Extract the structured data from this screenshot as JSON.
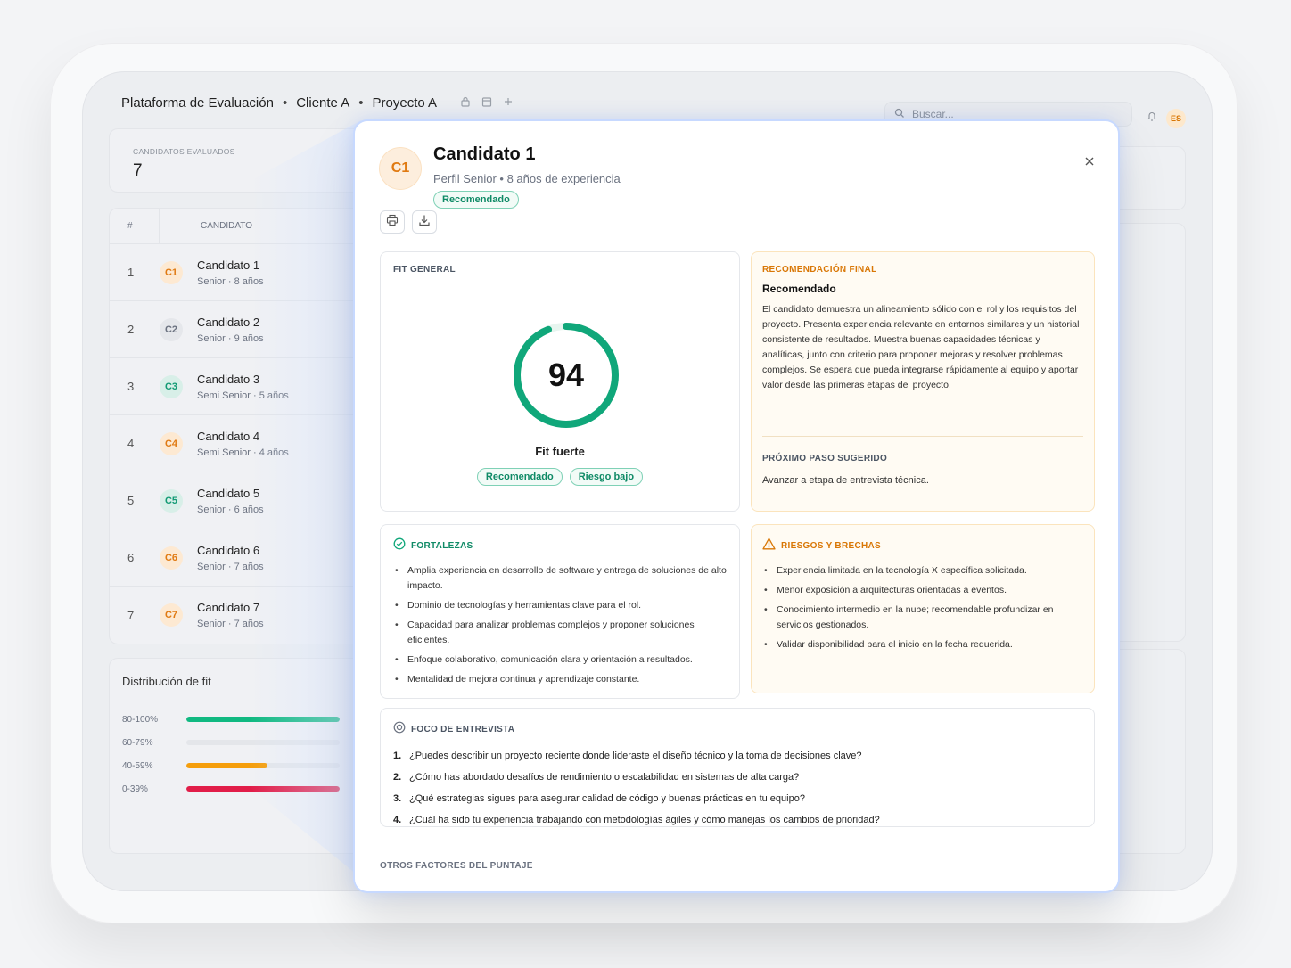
{
  "header": {
    "breadcrumbs": [
      "Plataforma de Evaluación",
      "Cliente A",
      "Proyecto A"
    ],
    "separator": "•",
    "search_placeholder": "Buscar...",
    "language": "ES"
  },
  "stats": {
    "label": "CANDIDATOS EVALUADOS",
    "value": "7"
  },
  "table": {
    "col_index": "#",
    "col_candidate": "CANDIDATO",
    "rows": [
      {
        "index": "1",
        "avatar": "C1",
        "name": "Candidato 1",
        "meta": "Senior · 8 años",
        "color": "orange"
      },
      {
        "index": "2",
        "avatar": "C2",
        "name": "Candidato 2",
        "meta": "Senior · 9 años",
        "color": "gray"
      },
      {
        "index": "3",
        "avatar": "C3",
        "name": "Candidato 3",
        "meta": "Semi Senior · 5 años",
        "color": "green"
      },
      {
        "index": "4",
        "avatar": "C4",
        "name": "Candidato 4",
        "meta": "Semi Senior · 4 años",
        "color": "orange"
      },
      {
        "index": "5",
        "avatar": "C5",
        "name": "Candidato 5",
        "meta": "Senior · 6 años",
        "color": "green"
      },
      {
        "index": "6",
        "avatar": "C6",
        "name": "Candidato 6",
        "meta": "Senior · 7 años",
        "color": "orange"
      },
      {
        "index": "7",
        "avatar": "C7",
        "name": "Candidato 7",
        "meta": "Senior · 7 años",
        "color": "orange"
      }
    ]
  },
  "distribution": {
    "title": "Distribución de fit",
    "bands": [
      {
        "label": "80-100%",
        "fraction": 1.0,
        "color": "#10b981"
      },
      {
        "label": "60-79%",
        "fraction": 0.0,
        "color": "#d1d5db"
      },
      {
        "label": "40-59%",
        "fraction": 0.53,
        "color": "#f59e0b"
      },
      {
        "label": "0-39%",
        "fraction": 1.0,
        "color": "#e11d48"
      }
    ]
  },
  "modal": {
    "avatar": "C1",
    "title": "Candidato 1",
    "subtitle": "Perfil Senior • 8 años de experiencia",
    "status_pill": "Recomendado",
    "fit": {
      "label": "FIT GENERAL",
      "score": "94",
      "score_fraction": 0.94,
      "score_color": "#10a77a",
      "verdict": "Fit fuerte",
      "pills": [
        "Recomendado",
        "Riesgo bajo"
      ]
    },
    "recommendation": {
      "label": "RECOMENDACIÓN FINAL",
      "title": "Recomendado",
      "text": "El candidato demuestra un alineamiento sólido con el rol y los requisitos del proyecto. Presenta experiencia relevante en entornos similares y un historial consistente de resultados. Muestra buenas capacidades técnicas y analíticas, junto con criterio para proponer mejoras y resolver problemas complejos. Se espera que pueda integrarse rápidamente al equipo y aportar valor desde las primeras etapas del proyecto.",
      "next_label": "PRÓXIMO PASO SUGERIDO",
      "next_text": "Avanzar a etapa de entrevista técnica."
    },
    "strengths": {
      "label": "FORTALEZAS",
      "items": [
        "Amplia experiencia en desarrollo de software y entrega de soluciones de alto impacto.",
        "Dominio de tecnologías y herramientas clave para el rol.",
        "Capacidad para analizar problemas complejos y proponer soluciones eficientes.",
        "Enfoque colaborativo, comunicación clara y orientación a resultados.",
        "Mentalidad de mejora continua y aprendizaje constante."
      ]
    },
    "risks": {
      "label": "RIESGOS Y BRECHAS",
      "items": [
        "Experiencia limitada en la tecnología X específica solicitada.",
        "Menor exposición a arquitecturas orientadas a eventos.",
        "Conocimiento intermedio en la nube; recomendable profundizar en servicios gestionados.",
        "Validar disponibilidad para el inicio en la fecha requerida."
      ]
    },
    "interview_focus": {
      "label": "FOCO DE ENTREVISTA",
      "questions": [
        "¿Puedes describir un proyecto reciente donde lideraste el diseño técnico y la toma de decisiones clave?",
        "¿Cómo has abordado desafíos de rendimiento o escalabilidad en sistemas de alta carga?",
        "¿Qué estrategias sigues para asegurar calidad de código y buenas prácticas en tu equipo?",
        "¿Cuál ha sido tu experiencia trabajando con metodologías ágiles y cómo manejas los cambios de prioridad?"
      ]
    },
    "others_label": "OTROS FACTORES DEL PUNTAJE"
  },
  "icons": [
    "lock-icon",
    "calendar-icon",
    "plus-icon",
    "search-icon",
    "bell-icon",
    "print-icon",
    "download-icon",
    "close-icon",
    "check-circle-icon",
    "warning-icon",
    "target-icon"
  ]
}
